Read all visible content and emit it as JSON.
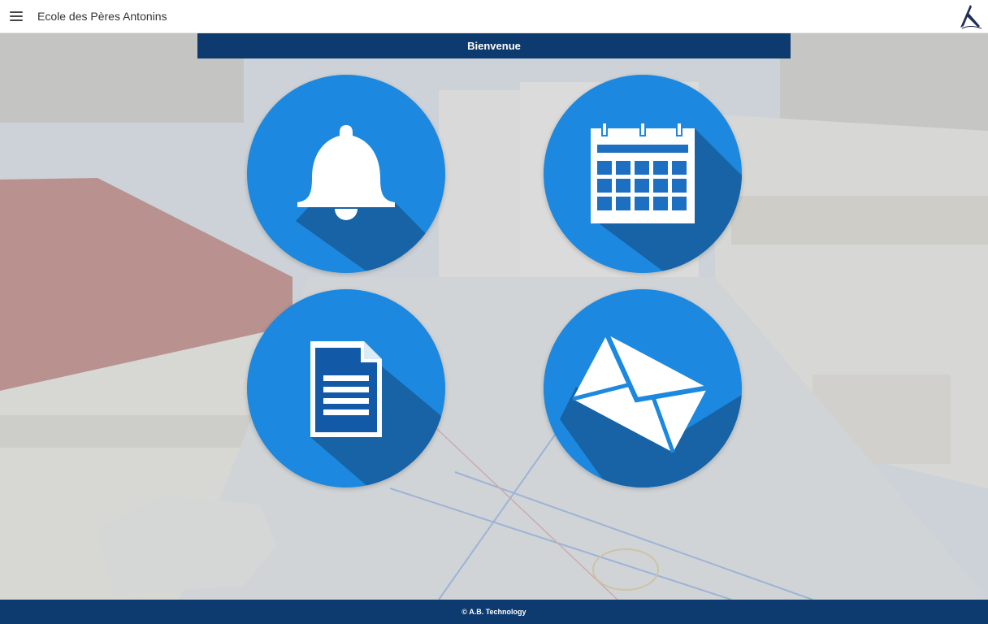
{
  "header": {
    "title": "Ecole des Pères Antonins",
    "menu_icon": "hamburger-menu-icon",
    "logo_icon": "school-logo-icon"
  },
  "banner": {
    "title": "Bienvenue"
  },
  "tiles": [
    {
      "icon": "bell-icon"
    },
    {
      "icon": "calendar-icon"
    },
    {
      "icon": "document-icon"
    },
    {
      "icon": "envelope-icon"
    }
  ],
  "colors": {
    "navy": "#0d3a6f",
    "tile_blue": "#1c88df",
    "tile_shadow": "#175fa0"
  },
  "footer": {
    "text": "© A.B. Technology"
  }
}
